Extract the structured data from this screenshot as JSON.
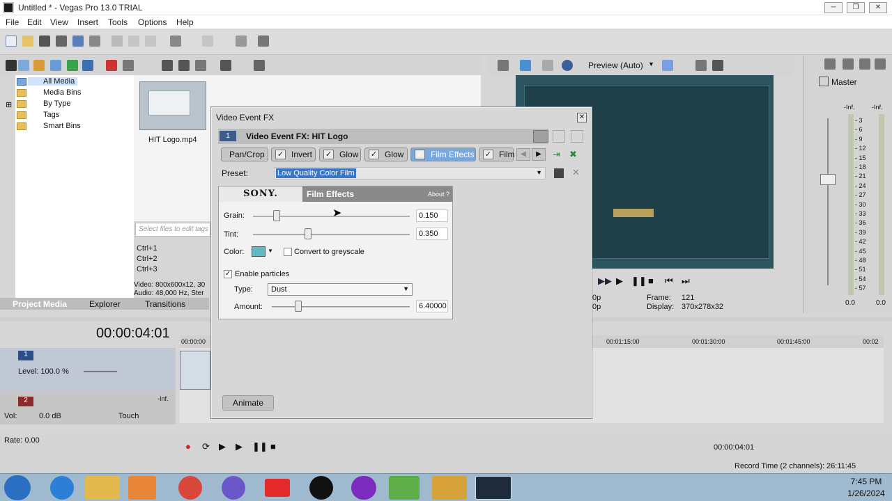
{
  "window": {
    "title": "Untitled * - Vegas Pro 13.0 TRIAL"
  },
  "menu": [
    "File",
    "Edit",
    "View",
    "Insert",
    "Tools",
    "Options",
    "Help"
  ],
  "media": {
    "tree": [
      "All Media",
      "Media Bins",
      "By Type",
      "Tags",
      "Smart Bins"
    ],
    "file_name": "HIT Logo.mp4",
    "tags_placeholder": "Select files to edit tags",
    "shortcuts": [
      "Ctrl+1",
      "Ctrl+2",
      "Ctrl+3"
    ],
    "video_info": "Video: 800x600x12, 30",
    "audio_info": "Audio: 48,000 Hz, Ster",
    "tabs": [
      "Project Media",
      "Explorer",
      "Transitions"
    ]
  },
  "preview": {
    "mode": "Preview (Auto)",
    "frame_label": "Frame:",
    "frame_value": "121",
    "display_label": "Display:",
    "display_value": "370x278x32",
    "res_a": "0p",
    "res_b": "0p"
  },
  "master": {
    "title": "Master",
    "inf_left": "-Inf.",
    "inf_right": "-Inf.",
    "scale": [
      "3",
      "6",
      "9",
      "12",
      "15",
      "18",
      "21",
      "24",
      "27",
      "30",
      "33",
      "36",
      "39",
      "42",
      "45",
      "48",
      "51",
      "54",
      "57"
    ],
    "bottom_left": "0.0",
    "bottom_right": "0.0"
  },
  "timeline": {
    "timecode": "00:00:04:01",
    "ruler": [
      "00:00:00",
      "00:01:15:00",
      "00:01:30:00",
      "00:01:45:00",
      "00:02"
    ],
    "track1": {
      "num": "1",
      "level": "Level: 100.0 %"
    },
    "track2": {
      "num": "2",
      "vol": "Vol:",
      "vol_value": "0.0 dB",
      "touch": "Touch",
      "inf": "-Inf."
    },
    "rate": "Rate: 0.00",
    "position": "00:00:04:01",
    "record_time": "Record Time (2 channels): 26:11:45"
  },
  "dialog": {
    "title": "Video Event FX",
    "fx_title": "Video Event FX:  HIT Logo",
    "chain": [
      "Pan/Crop",
      "Invert",
      "Glow",
      "Glow",
      "Film Effects",
      "Film"
    ],
    "preset_label": "Preset:",
    "preset_value": "Low Quality Color Film",
    "plugin_brand": "SONY.",
    "plugin_name": "Film Effects",
    "about": "About  ?",
    "grain_label": "Grain:",
    "grain_value": "0.150",
    "grain_level": 0.15,
    "tint_label": "Tint:",
    "tint_value": "0.350",
    "tint_level": 0.35,
    "color_label": "Color:",
    "color_swatch": "#5fbac4",
    "greyscale_label": "Convert to greyscale",
    "particles_label": "Enable particles",
    "type_label": "Type:",
    "type_value": "Dust",
    "amount_label": "Amount:",
    "amount_value": "6.40000",
    "animate": "Animate"
  },
  "taskbar": {
    "time": "7:45 PM",
    "date": "1/26/2024"
  }
}
